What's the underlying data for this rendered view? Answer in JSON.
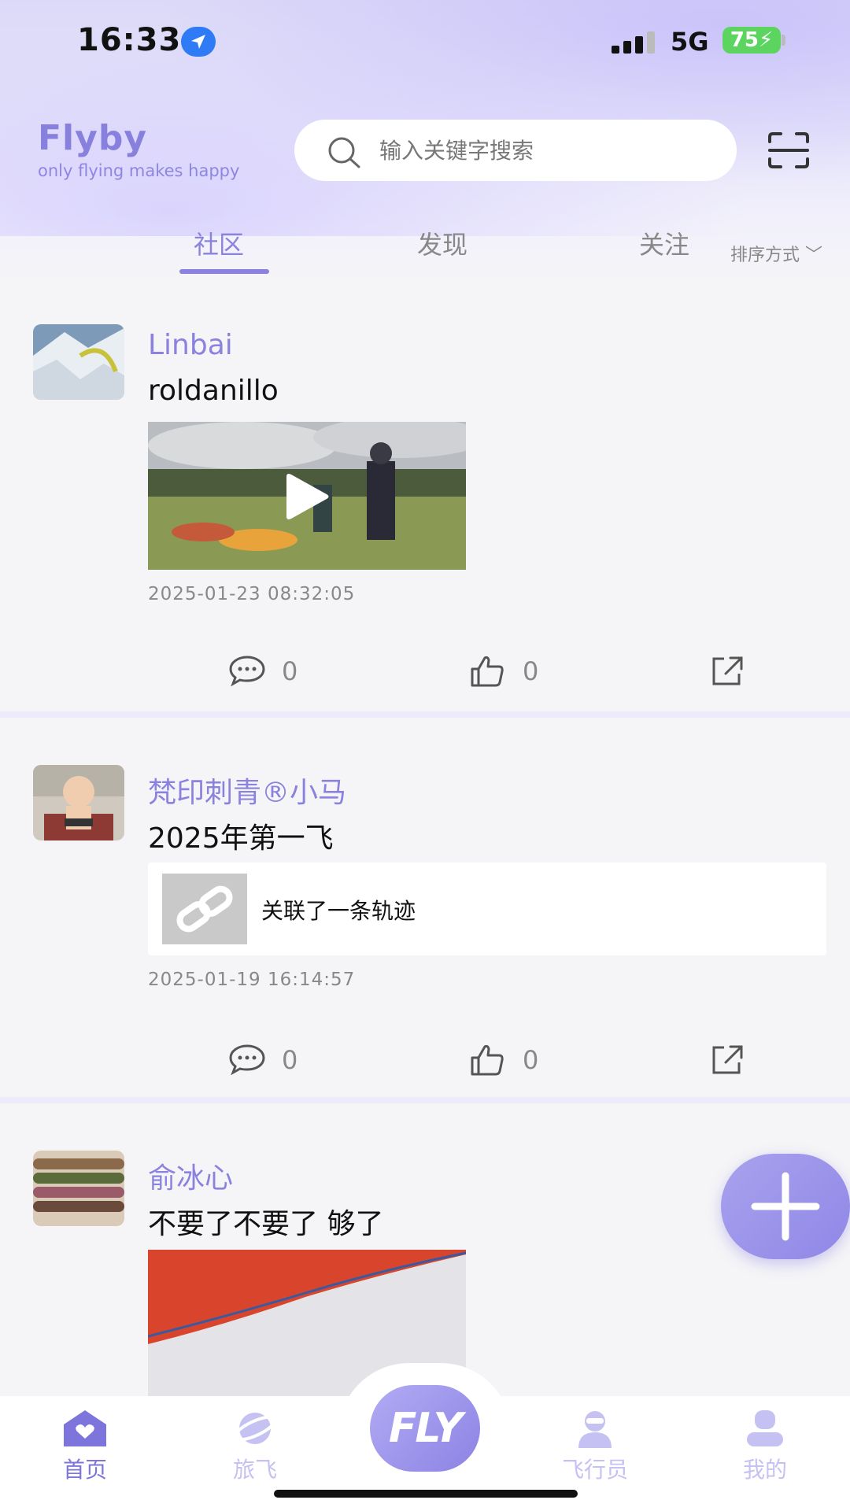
{
  "status_bar": {
    "time": "16:33",
    "network": "5G",
    "battery": "75"
  },
  "header": {
    "brand_title": "Flyby",
    "brand_subtitle": "only flying makes happy",
    "search_placeholder": "输入关键字搜索"
  },
  "tabs": [
    {
      "label": "社区",
      "active": true
    },
    {
      "label": "发现",
      "active": false
    },
    {
      "label": "关注",
      "active": false
    }
  ],
  "sort_label": "排序方式",
  "posts": [
    {
      "user": "Linbai",
      "text": "roldanillo",
      "timestamp": "2025-01-23 08:32:05",
      "comments": "0",
      "likes": "0",
      "attachment": "video"
    },
    {
      "user": "梵印刺青®小马",
      "text": "2025年第一飞",
      "timestamp": "2025-01-19 16:14:57",
      "comments": "0",
      "likes": "0",
      "attachment": "track",
      "link_label": "关联了一条轨迹"
    },
    {
      "user": "俞冰心",
      "text": "不要了不要了 够了",
      "attachment": "image"
    }
  ],
  "bottom_nav": {
    "items": [
      {
        "label": "首页",
        "icon": "home-icon",
        "active": true
      },
      {
        "label": "旅飞",
        "icon": "planet-icon",
        "active": false
      },
      {
        "label": "FLY",
        "icon": "fly-logo",
        "active": false
      },
      {
        "label": "飞行员",
        "icon": "pilot-icon",
        "active": false
      },
      {
        "label": "我的",
        "icon": "profile-icon",
        "active": false
      }
    ]
  },
  "colors": {
    "accent": "#8a82de",
    "battery": "#5bd560",
    "location": "#2f7bf6"
  }
}
